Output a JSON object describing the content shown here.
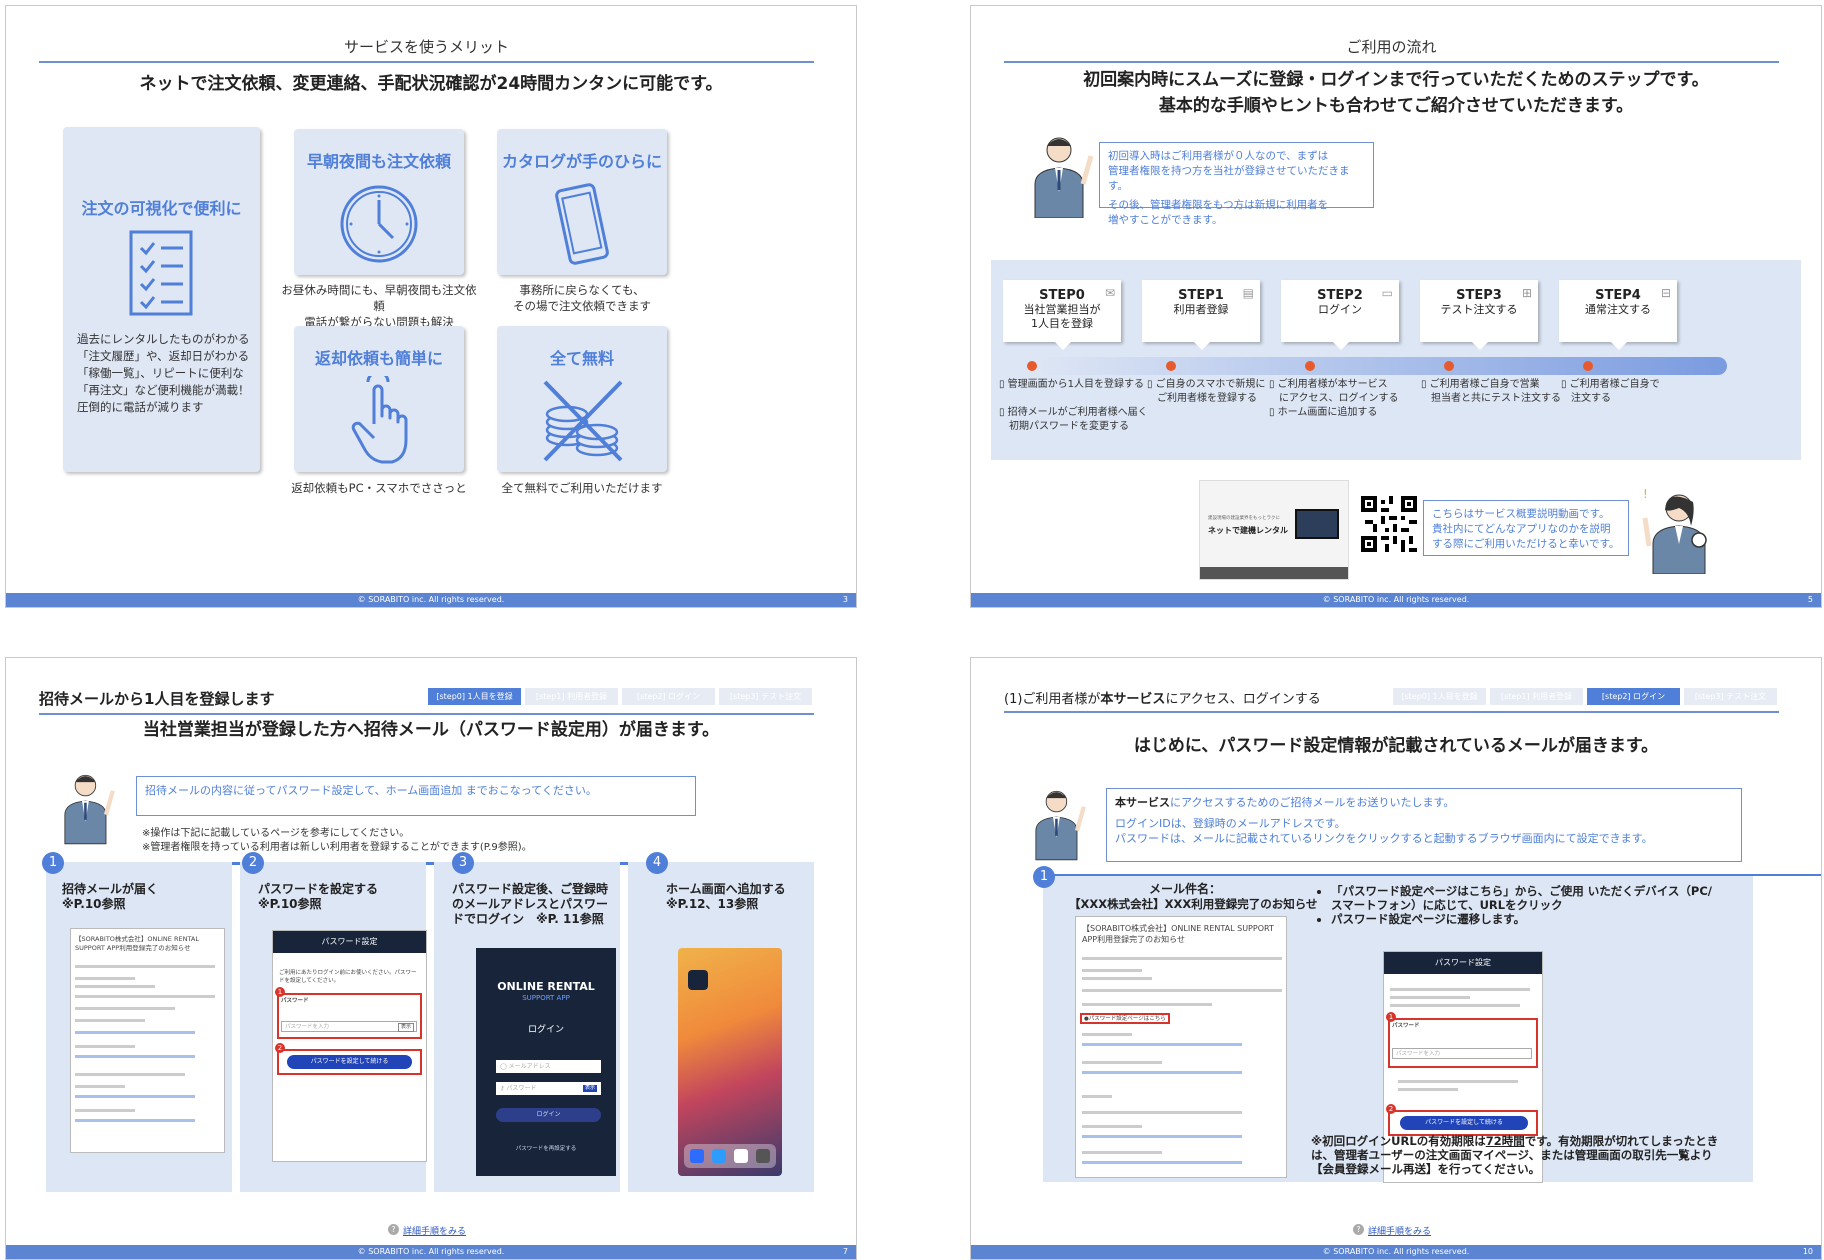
{
  "footer_text": "© SORABITO inc. All rights reserved.",
  "slide1": {
    "title": "サービスを使うメリット",
    "lead": "ネットで注文依頼、変更連絡、手配状況確認が24時間カンタンに可能です。",
    "page": "3",
    "cards": [
      {
        "title": "注文の可視化で便利に",
        "icon": "checklist-icon",
        "body": "過去にレンタルしたものがわかる\n「注文履歴」や、返却日がわかる\n「稼働一覧」、リピートに便利な\n「再注文」など便利機能が満載！\n圧倒的に電話が減ります"
      },
      {
        "title": "早朝夜間も注文依頼",
        "icon": "clock-icon",
        "caption": "お昼休み時間にも、早朝夜間も注文依頼\n電話が繋がらない問題も解決"
      },
      {
        "title": "カタログが手のひらに",
        "icon": "smartphone-icon",
        "caption": "事務所に戻らなくても、\nその場で注文依頼できます"
      },
      {
        "title": "返却依頼も簡単に",
        "icon": "tap-hand-icon",
        "caption": "返却依頼もPC・スマホでささっと"
      },
      {
        "title": "全て無料",
        "icon": "crossed-coins-icon",
        "caption": "全て無料でご利用いただけます"
      }
    ]
  },
  "slide2": {
    "title": "ご利用の流れ",
    "lead_line1": "初回案内時にスムーズに登録・ログインまで行っていただくためのステップです。",
    "lead_line2": "基本的な手順やヒントも合わせてご紹介させていただきます。",
    "page": "5",
    "bubble_p1": "初回導入時はご利用者様が０人なので、まずは\n管理者権限を持つ方を当社が登録させていただきます。",
    "bubble_p2": "その後、管理者権限をもつ方は新規に利用者を\n増やすことができます。",
    "steps": [
      {
        "name": "STEP0",
        "label": "当社営業担当が\n1人目を登録",
        "desc": "▯ 管理画面から1人目を登録する\n\n▯ 招待メールがご利用者様へ届く\n　初期パスワードを変更する"
      },
      {
        "name": "STEP1",
        "label": "利用者登録",
        "desc": "▯ ご自身のスマホで新規に\n　ご利用者様を登録する"
      },
      {
        "name": "STEP2",
        "label": "ログイン",
        "desc": "▯ ご利用者様が本サービス\n　にアクセス、ログインする\n▯ ホーム画面に追加する"
      },
      {
        "name": "STEP3",
        "label": "テスト注文する",
        "desc": "▯ ご利用者様ご自身で営業\n　担当者と共にテスト注文する"
      },
      {
        "name": "STEP4",
        "label": "通常注文する",
        "desc": "▯ ご利用者様ご自身で\n　注文する"
      }
    ],
    "video_title": "ネットで建機レンタル",
    "video_caption": "建設現場の建設業界をもっとラクに",
    "video_bubble": "こちらはサービス概要説明動画です。\n貴社内にてどんなアプリなのかを説明\nする際にご利用いただけると幸いです。"
  },
  "slide3": {
    "title": "招待メールから1人目を登録します",
    "tabs": [
      "[step0] 1人目を登録",
      "[step1] 利用者登録",
      "[step2] ログイン",
      "[step3] テスト注文"
    ],
    "lead": "当社営業担当が登録した方へ招待メール（パスワード設定用）が届きます。",
    "bubble": "招待メールの内容に従ってパスワード設定して、ホーム画面追加 までおこなってください。",
    "note1": "※操作は下記に記載しているページを参考にしてください。",
    "note2": "※管理者権限を持っている利用者は新しい利用者を登録することができます(P.9参照)。",
    "page": "7",
    "columns": [
      {
        "num": "1",
        "title": "招待メールが届く\n※P.10参照"
      },
      {
        "num": "2",
        "title": "パスワードを設定する\n※P.10参照"
      },
      {
        "num": "3",
        "title": "パスワード設定後、ご登録時\nのメールアドレスとパスワー\nドでログイン　※P. 11参照"
      },
      {
        "num": "4",
        "title": "ホーム画面へ追加する\n※P.12、13参照"
      }
    ],
    "mail_subject": "【SORABITO株式会社】ONLINE RENTAL SUPPORT APP利用登録完了のお知らせ",
    "pw_header": "パスワード設定",
    "pw_intro": "ご利用にあたりログイン前にお使いください。パスワードを設定してください。",
    "pw_label": "パスワード",
    "pw_placeholder": "パスワードを入力",
    "pw_show": "表示",
    "pw_button": "パスワードを設定して続ける",
    "app_title": "ONLINE RENTAL",
    "app_sub": "SUPPORT APP",
    "login_label": "ログイン",
    "email_placeholder": "メールアドレス",
    "password_placeholder": "パスワード",
    "login_button": "ログイン",
    "reset_link": "パスワードを再設定する",
    "help_link": "詳細手順をみる"
  },
  "slide4": {
    "title_prefix": "(1)ご利用者様が",
    "title_bold": "本サービス",
    "title_suffix": "にアクセス、ログインする",
    "tabs": [
      "[step0] 1人目を登録",
      "[step1] 利用者登録",
      "[step2] ログイン",
      "[step3] テスト注文"
    ],
    "lead": "はじめに、パスワード設定情報が記載されているメールが届きます。",
    "bubble_bold": "本サービス",
    "bubble_l1": "にアクセスするためのご招待メールをお送りいたします。",
    "bubble_l2": "ログインIDは、登録時のメールアドレスです。",
    "bubble_l3": "パスワードは、メールに記載されているリンクをクリックすると起動するブラウザ画面内にて設定できます。",
    "num": "1",
    "mail_label": "メール件名：",
    "mail_subject_line": "【XXX株式会社】XXX利用登録完了のお知らせ",
    "bullet1": "「パスワード設定ページはこちら」から、ご使用 いただくデバイス（PC/ スマートフォン）に応じて、URLをクリック",
    "bullet2": "パスワード設定ページに遷移します。",
    "mail_subject": "【SORABITO株式会社】ONLINE RENTAL SUPPORT APP利用登録完了のお知らせ",
    "mail_pw_link": "●パスワード設定ページはこちら",
    "pw_header": "パスワード設定",
    "pw_label": "パスワード",
    "pw_placeholder": "パスワードを入力",
    "pw_button": "パスワードを設定して続ける",
    "note_pre": "※初回ログインURLの有効期限は",
    "note_hours": "72時間",
    "note_post": "です。有効期限が切れてしまったときは、管理者ユーザーの注文画面マイページ、または管理画面の取引先一覧より【会員登録メール再送】を行ってください。",
    "page": "10",
    "help_link": "詳細手順をみる"
  }
}
